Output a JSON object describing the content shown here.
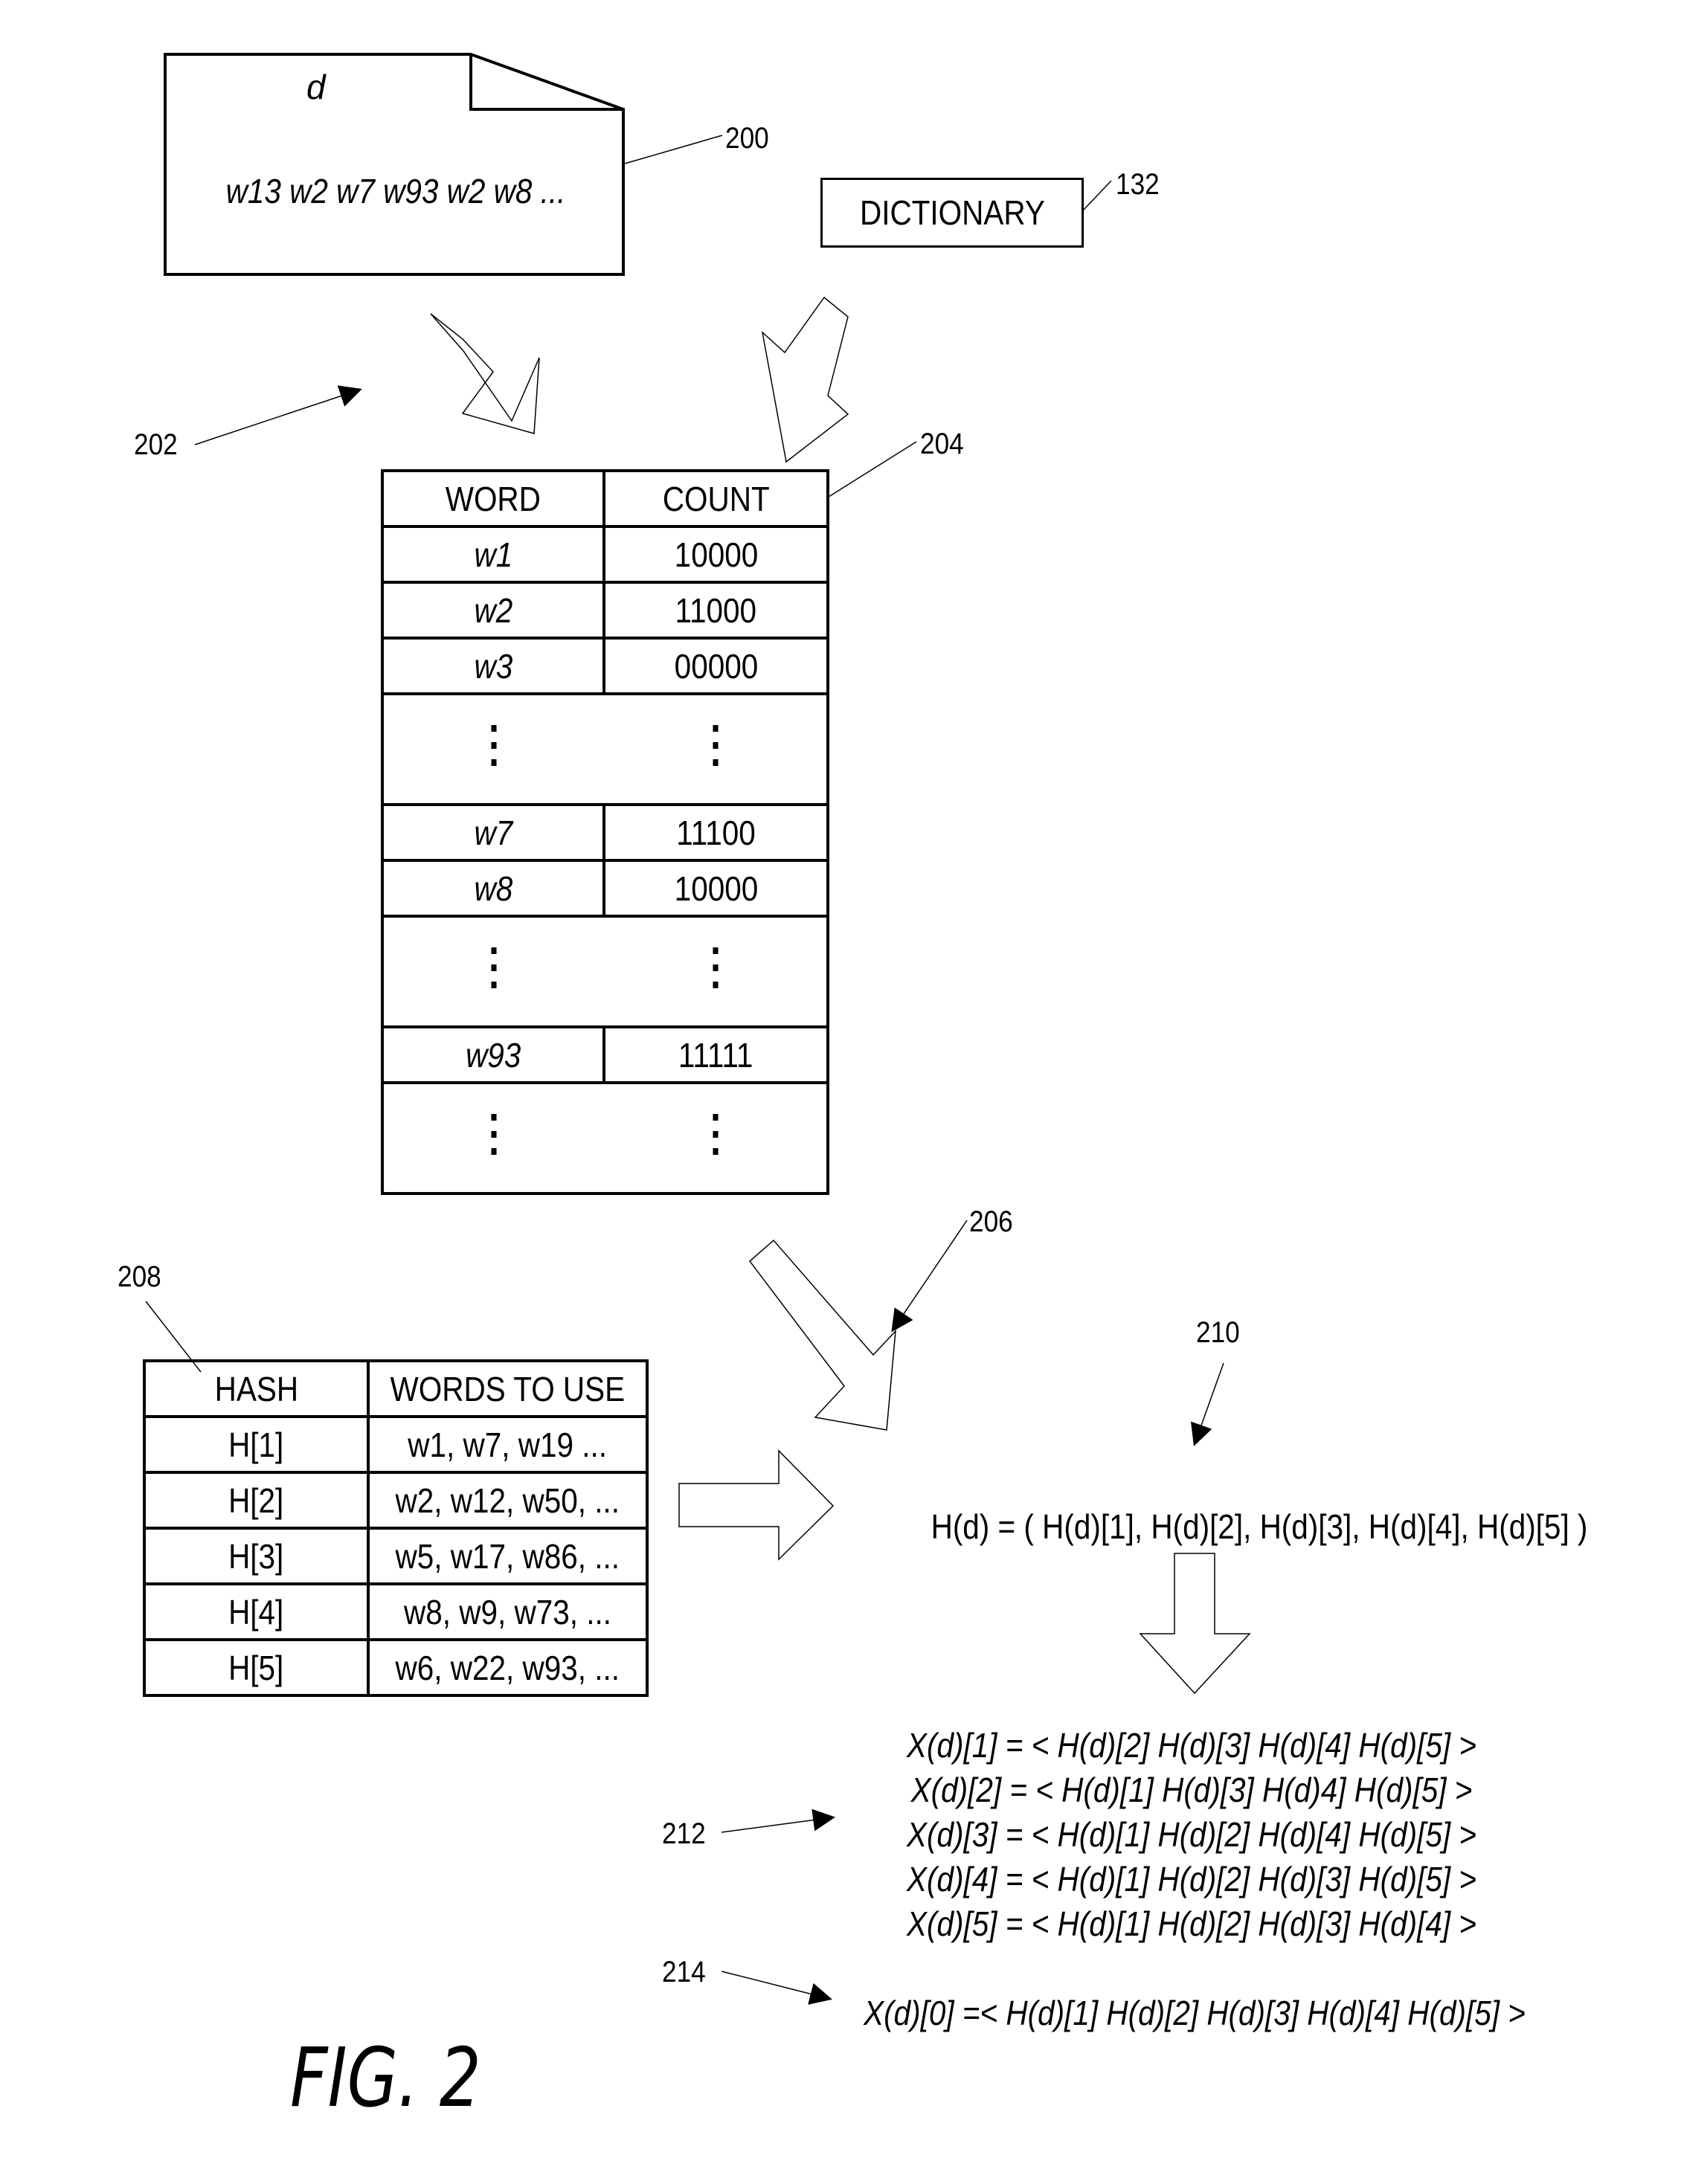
{
  "figure": {
    "caption": "FIG. 2"
  },
  "document": {
    "ref": "200",
    "title": "d",
    "content": "w13 w2 w7 w93 w2 w8 ..."
  },
  "dictionary": {
    "ref": "132",
    "label": "DICTIONARY"
  },
  "process_arrow": {
    "ref": "202"
  },
  "word_count_table": {
    "ref": "204",
    "headers": [
      "WORD",
      "COUNT"
    ],
    "rows": [
      {
        "word": "w1",
        "count": "10000"
      },
      {
        "word": "w2",
        "count": "11000"
      },
      {
        "word": "w3",
        "count": "00000"
      },
      {
        "ellipsis": true
      },
      {
        "word": "w7",
        "count": "11100"
      },
      {
        "word": "w8",
        "count": "10000"
      },
      {
        "ellipsis": true
      },
      {
        "word": "w93",
        "count": "11111"
      },
      {
        "ellipsis": true
      }
    ]
  },
  "hash_arrow": {
    "ref": "206"
  },
  "hash_table": {
    "ref": "208",
    "headers": [
      "HASH",
      "WORDS TO USE"
    ],
    "rows": [
      {
        "hash": "H[1]",
        "words": "w1, w7, w19 ..."
      },
      {
        "hash": "H[2]",
        "words": "w2, w12, w50, ..."
      },
      {
        "hash": "H[3]",
        "words": "w5, w17, w86, ..."
      },
      {
        "hash": "H[4]",
        "words": "w8, w9, w73, ..."
      },
      {
        "hash": "H[5]",
        "words": "w6, w22, w93, ..."
      }
    ]
  },
  "hash_vector": {
    "ref": "210",
    "formula": "H(d) = ( H(d)[1], H(d)[2], H(d)[3], H(d)[4], H(d)[5] )"
  },
  "sub_vectors": {
    "ref": "212",
    "lines": [
      "X(d)[1] =  < H(d)[2] H(d)[3] H(d)[4] H(d)[5] >",
      "X(d)[2] =  < H(d)[1] H(d)[3] H(d)4] H(d)[5] >",
      "X(d)[3] =  < H(d)[1] H(d)[2] H(d)[4] H(d)[5] >",
      "X(d)[4] =  < H(d)[1] H(d)[2] H(d)[3] H(d)[5] >",
      "X(d)[5] =  < H(d)[1] H(d)[2] H(d)[3] H(d)[4] >"
    ]
  },
  "full_vector": {
    "ref": "214",
    "formula": "X(d)[0] =< H(d)[1] H(d)[2] H(d)[3] H(d)[4] H(d)[5] >"
  }
}
